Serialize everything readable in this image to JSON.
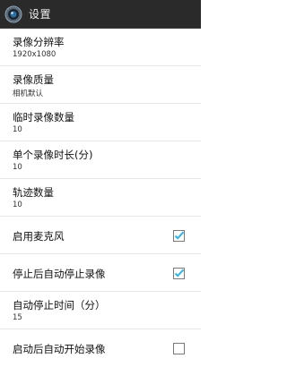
{
  "actionbar": {
    "title": "设置",
    "icon": "camera-lens-icon"
  },
  "colors": {
    "actionbar_bg": "#2a2a2a",
    "accent": "#33b5e5",
    "divider": "#e6e6e6"
  },
  "settings": [
    {
      "title": "录像分辨率",
      "summary": "1920x1080"
    },
    {
      "title": "录像质量",
      "summary": "相机默认"
    },
    {
      "title": "临时录像数量",
      "summary": "10"
    },
    {
      "title": "单个录像时长(分)",
      "summary": "10"
    },
    {
      "title": "轨迹数量",
      "summary": "10"
    },
    {
      "title": "启用麦克风",
      "checked": true
    },
    {
      "title": "停止后自动停止录像",
      "checked": true
    },
    {
      "title": "自动停止时间（分）",
      "summary": "15"
    },
    {
      "title": "启动后自动开始录像",
      "checked": false
    }
  ]
}
